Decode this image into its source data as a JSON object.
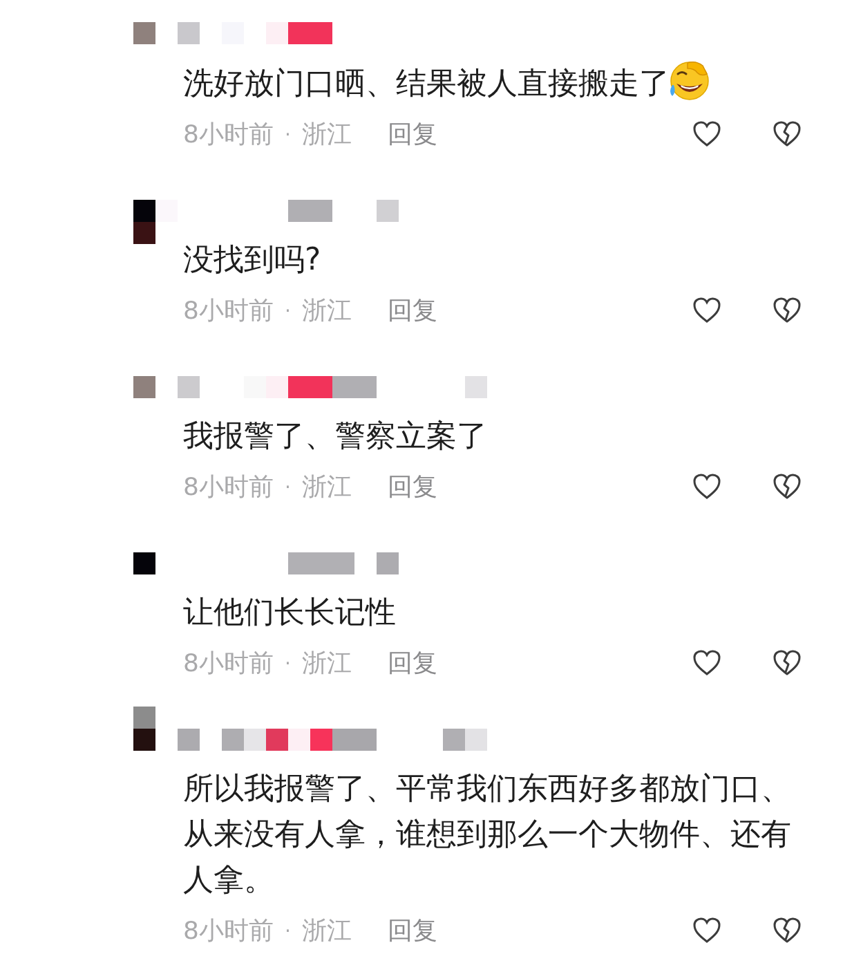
{
  "comments": [
    {
      "text": "洗好放门口晒、结果被人直接搬走了",
      "trailing_emoji": true,
      "time": "8小时前",
      "separator": "·",
      "location": "浙江",
      "reply": "回复"
    },
    {
      "text": "没找到吗?",
      "trailing_emoji": false,
      "time": "8小时前",
      "separator": "·",
      "location": "浙江",
      "reply": "回复"
    },
    {
      "text": "我报警了、警察立案了",
      "trailing_emoji": false,
      "time": "8小时前",
      "separator": "·",
      "location": "浙江",
      "reply": "回复"
    },
    {
      "text": "让他们长长记性",
      "trailing_emoji": false,
      "time": "8小时前",
      "separator": "·",
      "location": "浙江",
      "reply": "回复"
    },
    {
      "text": "所以我报警了、平常我们东西好多都放门口、从来没有人拿，谁想到那么一个大物件、还有人拿。",
      "trailing_emoji": false,
      "time": "8小时前",
      "separator": "·",
      "location": "浙江",
      "reply": "回复"
    }
  ]
}
